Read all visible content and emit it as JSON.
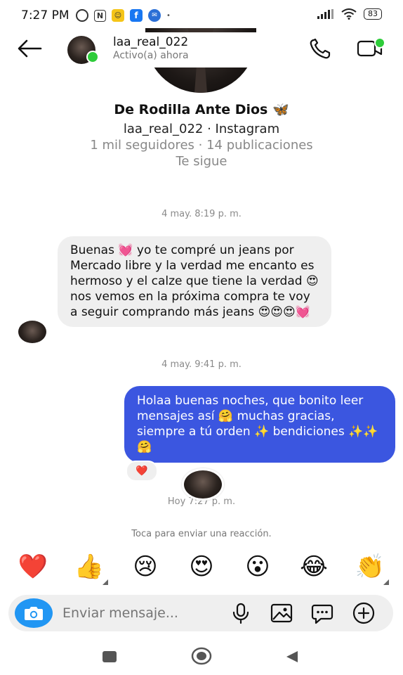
{
  "status_bar": {
    "time": "7:27 PM",
    "battery": "83"
  },
  "header": {
    "username": "laa_real_022",
    "status": "Activo(a) ahora"
  },
  "profile": {
    "display_name": "De Rodilla Ante Dios 🦋",
    "handle_line": "laa_real_022 · Instagram",
    "stats": "1 mil seguidores · 14 publicaciones",
    "follows_you": "Te sigue"
  },
  "messages": {
    "ts1": "4 may. 8:19 p. m.",
    "incoming_text": "Buenas 💓 yo te compré un jeans por Mercado libre y la verdad me encanto es hermoso y el calze que tiene la verdad 😍 nos vemos en la próxima compra te voy a seguir comprando más jeans 😍😍😍💓",
    "ts2": "4 may. 9:41 p. m.",
    "outgoing_text": "Holaa buenas noches, que bonito leer mensajes así 🤗 muchas gracias, siempre a tú orden ✨ bendiciones ✨✨🤗",
    "reaction": "❤️",
    "ts3": "Hoy 7:27 p. m."
  },
  "reaction_hint": "Toca para enviar una reacción.",
  "quick_reactions": [
    "❤️",
    "👍",
    "😢",
    "😍",
    "😮",
    "😂",
    "👏"
  ],
  "composer": {
    "placeholder": "Enviar mensaje..."
  },
  "colors": {
    "outgoing_bubble": "#3b56e0",
    "camera_button": "#2196f3",
    "online": "#2ecc3a"
  }
}
